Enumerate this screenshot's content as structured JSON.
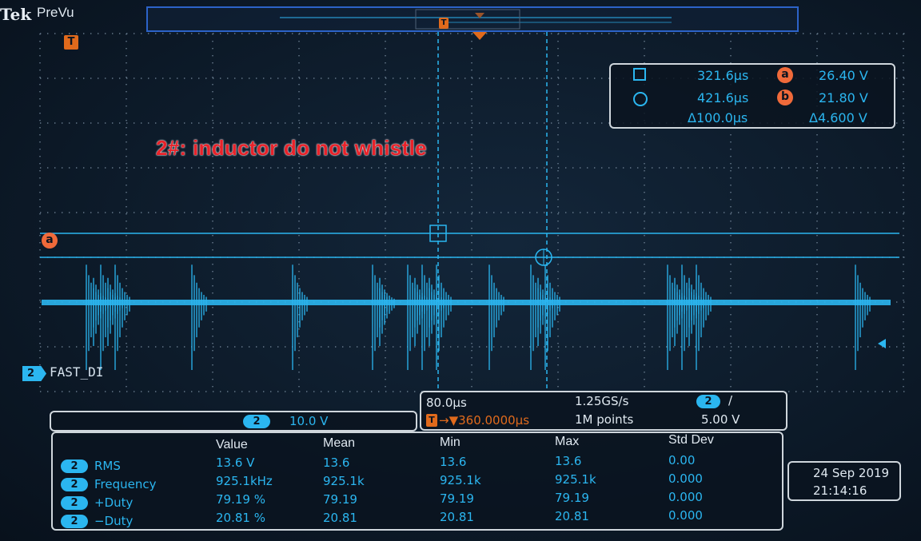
{
  "header": {
    "brand": "Tek",
    "mode": "PreVu"
  },
  "overview": {
    "trigger_marker": "T"
  },
  "cursor_readout": {
    "row_a": {
      "shape": "square-icon",
      "time": "321.6μs",
      "letter": "a",
      "volt": "26.40 V"
    },
    "row_b": {
      "shape": "circle-icon",
      "time": "421.6μs",
      "letter": "b",
      "volt": "21.80 V"
    },
    "delta_time": "Δ100.0μs",
    "delta_volt": "Δ4.600 V"
  },
  "annotation": "2#:  inductor do not whistle",
  "channel_a_label": "a",
  "channel2": {
    "number": "2",
    "name": "FAST_DI"
  },
  "scale_panel": {
    "channel": "2",
    "volts_per_div": "10.0 V"
  },
  "timebase_panel": {
    "time_per_div": "80.0μs",
    "sample_rate": "1.25GS/s",
    "trigger_channel": "2",
    "trigger_slope": "/",
    "trigger_symbol": "T",
    "trigger_position": "→▼360.0000μs",
    "record_length": "1M points",
    "trigger_level": "5.00 V"
  },
  "measurements": {
    "headers": [
      "Value",
      "Mean",
      "Min",
      "Max",
      "Std Dev"
    ],
    "rows": [
      {
        "ch": "2",
        "name": "RMS",
        "value": "13.6 V",
        "mean": "13.6",
        "min": "13.6",
        "max": "13.6",
        "std": "0.00"
      },
      {
        "ch": "2",
        "name": "Frequency",
        "value": "925.1kHz",
        "mean": "925.1k",
        "min": "925.1k",
        "max": "925.1k",
        "std": "0.000"
      },
      {
        "ch": "2",
        "name": "+Duty",
        "value": "79.19 %",
        "mean": "79.19",
        "min": "79.19",
        "max": "79.19",
        "std": "0.000"
      },
      {
        "ch": "2",
        "name": "−Duty",
        "value": "20.81 %",
        "mean": "20.81",
        "min": "20.81",
        "max": "20.81",
        "std": "0.000"
      }
    ]
  },
  "datetime": {
    "date": "24 Sep  2019",
    "time": "21:14:16"
  },
  "colors": {
    "trace": "#2bb6f0",
    "cursor": "#2bb6f0",
    "trigger": "#e06a1c",
    "annotation": "#e8222a",
    "grid": "#6c7f92"
  }
}
